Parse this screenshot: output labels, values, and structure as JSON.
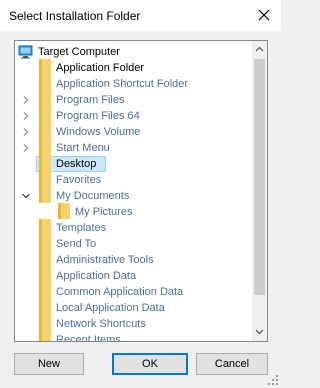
{
  "window": {
    "title": "Select Installation Folder"
  },
  "tree": {
    "root": "Target Computer",
    "items": [
      {
        "label": "Application Folder",
        "indent": 1,
        "expander": "",
        "dark": true
      },
      {
        "label": "Application Shortcut Folder",
        "indent": 1,
        "expander": "",
        "dark": false
      },
      {
        "label": "Program Files",
        "indent": 1,
        "expander": "collapsed",
        "dark": false
      },
      {
        "label": "Program Files 64",
        "indent": 1,
        "expander": "collapsed",
        "dark": false
      },
      {
        "label": "Windows Volume",
        "indent": 1,
        "expander": "collapsed",
        "dark": false
      },
      {
        "label": "Start Menu",
        "indent": 1,
        "expander": "collapsed",
        "dark": false
      },
      {
        "label": "Desktop",
        "indent": 1,
        "expander": "",
        "dark": true,
        "selected": true
      },
      {
        "label": "Favorites",
        "indent": 1,
        "expander": "",
        "dark": false
      },
      {
        "label": "My Documents",
        "indent": 1,
        "expander": "expanded",
        "dark": false
      },
      {
        "label": "My Pictures",
        "indent": 2,
        "expander": "",
        "dark": false
      },
      {
        "label": "Templates",
        "indent": 1,
        "expander": "",
        "dark": false
      },
      {
        "label": "Send To",
        "indent": 1,
        "expander": "",
        "dark": false
      },
      {
        "label": "Administrative Tools",
        "indent": 1,
        "expander": "",
        "dark": false
      },
      {
        "label": "Application Data",
        "indent": 1,
        "expander": "",
        "dark": false
      },
      {
        "label": "Common Application Data",
        "indent": 1,
        "expander": "",
        "dark": false
      },
      {
        "label": "Local Application Data",
        "indent": 1,
        "expander": "",
        "dark": false
      },
      {
        "label": "Network Shortcuts",
        "indent": 1,
        "expander": "",
        "dark": false
      },
      {
        "label": "Recent Items",
        "indent": 1,
        "expander": "",
        "dark": false
      }
    ]
  },
  "buttons": {
    "new": "New",
    "ok": "OK",
    "cancel": "Cancel"
  },
  "icons": {
    "close": "close-icon",
    "computer": "computer-icon",
    "folder": "folder-icon"
  },
  "colors": {
    "folder": "#f7d467",
    "selection": "#cce8ff",
    "item_text": "#4a6e9a"
  }
}
